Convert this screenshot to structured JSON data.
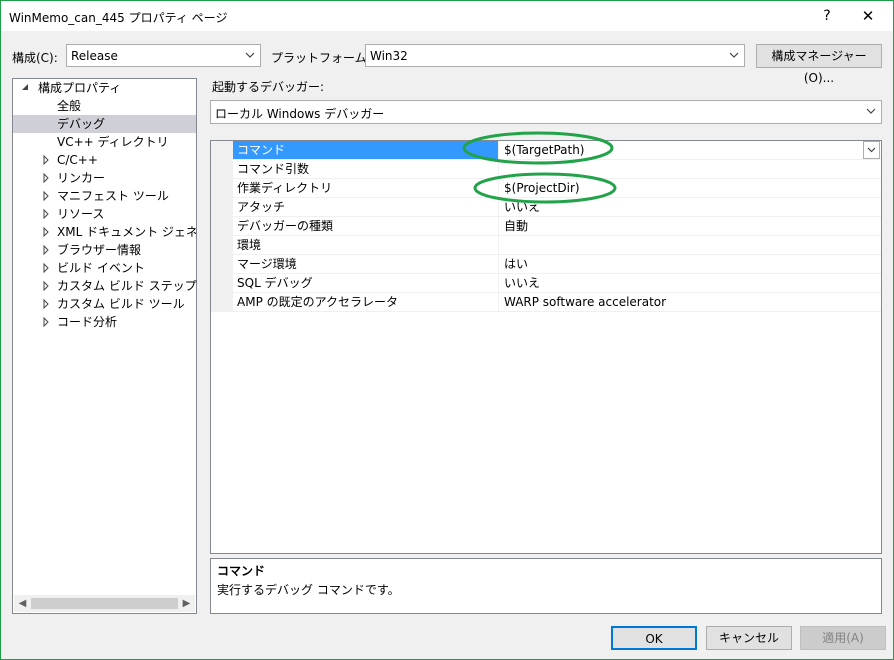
{
  "window": {
    "title": "WinMemo_can_445 プロパティ ページ",
    "help_glyph": "?",
    "close_glyph": "✕"
  },
  "toolbar": {
    "config_label": "構成(C):",
    "config_value": "Release",
    "platform_label": "プラットフォーム(P):",
    "platform_value": "Win32",
    "config_manager_label": "構成マネージャー(O)..."
  },
  "tree": {
    "root": "構成プロパティ",
    "items": [
      {
        "label": "全般"
      },
      {
        "label": "デバッグ"
      },
      {
        "label": "VC++ ディレクトリ"
      },
      {
        "label": "C/C++"
      },
      {
        "label": "リンカー"
      },
      {
        "label": "マニフェスト ツール"
      },
      {
        "label": "リソース"
      },
      {
        "label": "XML ドキュメント ジェネレーター"
      },
      {
        "label": "ブラウザー情報"
      },
      {
        "label": "ビルド イベント"
      },
      {
        "label": "カスタム ビルド ステップ"
      },
      {
        "label": "カスタム ビルド ツール"
      },
      {
        "label": "コード分析"
      }
    ]
  },
  "debugger": {
    "label": "起動するデバッガー:",
    "value": "ローカル Windows デバッガー"
  },
  "properties": [
    {
      "name": "コマンド",
      "value": "$(TargetPath)"
    },
    {
      "name": "コマンド引数",
      "value": ""
    },
    {
      "name": "作業ディレクトリ",
      "value": "$(ProjectDir)"
    },
    {
      "name": "アタッチ",
      "value": "いいえ"
    },
    {
      "name": "デバッガーの種類",
      "value": "自動"
    },
    {
      "name": "環境",
      "value": ""
    },
    {
      "name": "マージ環境",
      "value": "はい"
    },
    {
      "name": "SQL デバッグ",
      "value": "いいえ"
    },
    {
      "name": "AMP の既定のアクセラレータ",
      "value": "WARP software accelerator"
    }
  ],
  "description": {
    "title": "コマンド",
    "text": "実行するデバッグ コマンドです。"
  },
  "buttons": {
    "ok": "OK",
    "cancel": "キャンセル",
    "apply": "適用(A)"
  },
  "colors": {
    "selection": "#3399ff",
    "tree_selection": "#cfcfd8",
    "annotation": "#22a34a"
  }
}
